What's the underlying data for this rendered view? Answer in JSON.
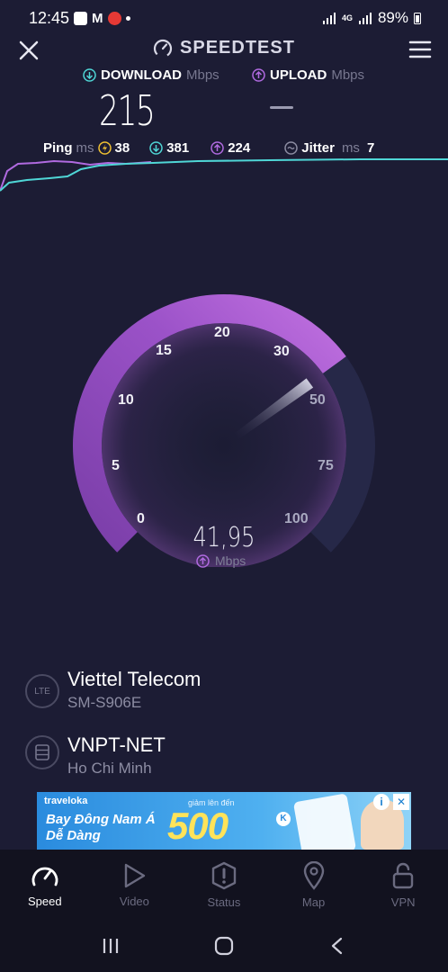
{
  "status_bar": {
    "time": "12:45",
    "battery": "89%",
    "network": "4G"
  },
  "header": {
    "brand": "SPEEDTEST"
  },
  "download": {
    "label": "DOWNLOAD",
    "unit": "Mbps",
    "value": "215"
  },
  "upload": {
    "label": "UPLOAD",
    "unit": "Mbps",
    "value": "—"
  },
  "ping": {
    "label": "Ping",
    "unit": "ms",
    "idle": "38",
    "download": "381",
    "upload": "224",
    "jitter_label": "Jitter",
    "jitter_unit": "ms",
    "jitter": "7"
  },
  "gauge": {
    "ticks": [
      "0",
      "5",
      "10",
      "15",
      "20",
      "30",
      "50",
      "75",
      "100"
    ],
    "value": "41,95",
    "unit": "Mbps",
    "reading_mbps": 41.95,
    "colors": {
      "fill": "#a35ed2",
      "track": "#262848"
    }
  },
  "providers": [
    {
      "badge": "LTE",
      "name": "Viettel Telecom",
      "sub": "SM-S906E"
    },
    {
      "badge": "",
      "name": "VNPT-NET",
      "sub": "Ho Chi Minh"
    }
  ],
  "ad": {
    "brand": "traveloka",
    "title_line1": "Bay Đông Nam Á",
    "title_line2": "Dễ Dàng",
    "small": "giảm lên đến",
    "number": "500",
    "k": "K"
  },
  "nav": [
    {
      "label": "Speed",
      "icon": "speedometer-icon",
      "active": true
    },
    {
      "label": "Video",
      "icon": "play-icon",
      "active": false
    },
    {
      "label": "Status",
      "icon": "alert-icon",
      "active": false
    },
    {
      "label": "Map",
      "icon": "map-pin-icon",
      "active": false
    },
    {
      "label": "VPN",
      "icon": "lock-icon",
      "active": false
    }
  ],
  "accent": {
    "purple": "#b06ae0",
    "cyan": "#4fd6d6"
  }
}
